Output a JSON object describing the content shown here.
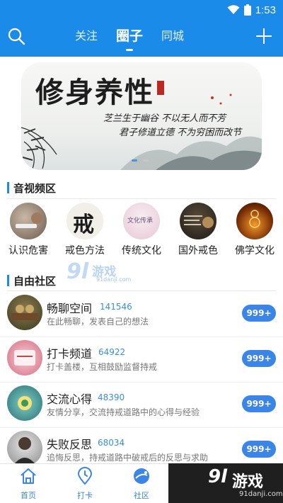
{
  "status": {
    "time": "1:53",
    "wifi_icon": "wifi-icon",
    "battery_icon": "battery-icon"
  },
  "nav": {
    "tabs": [
      {
        "label": "关注",
        "active": false
      },
      {
        "label": "圈子",
        "active": true
      },
      {
        "label": "同城",
        "active": false
      }
    ]
  },
  "banner": {
    "title": "修身养性",
    "line1": "芝兰生于幽谷 不以无人而不芳",
    "line2": "君子修道立德 不为穷困而改节",
    "page_count": 2,
    "active_page": 1
  },
  "av_section": {
    "title": "音视频区",
    "items": [
      {
        "label": "认识危害"
      },
      {
        "label": "戒色方法",
        "thumb_text": "戒"
      },
      {
        "label": "传统文化",
        "thumb_text": "文化传承"
      },
      {
        "label": "国外戒色"
      },
      {
        "label": "佛学文化"
      }
    ]
  },
  "community": {
    "title": "自由社区",
    "items": [
      {
        "title": "畅聊空间",
        "count": "141546",
        "desc": "在此畅聊，发表自己的想法",
        "badge": "999+"
      },
      {
        "title": "打卡频道",
        "count": "64922",
        "desc": "打卡盖楼，互相鼓励监督持戒",
        "badge": "999+"
      },
      {
        "title": "交流心得",
        "count": "48390",
        "desc": "友情分享，交流持戒道路中的心得与经验",
        "badge": "999+"
      },
      {
        "title": "失败反思",
        "count": "68034",
        "desc": "追悔反思，持戒道路中破戒后的反思与求助",
        "badge": "999+"
      }
    ]
  },
  "tabbar": {
    "items": [
      {
        "label": "首页",
        "icon": "home-icon"
      },
      {
        "label": "打卡",
        "icon": "location-pin-icon"
      },
      {
        "label": "社区",
        "icon": "community-icon"
      }
    ]
  },
  "watermark": {
    "number": "9l",
    "text": "游戏",
    "url": "91danji.com"
  },
  "colors": {
    "primary": "#1a8be8",
    "badge": "#3a85e6",
    "count": "#3a8fd9"
  }
}
